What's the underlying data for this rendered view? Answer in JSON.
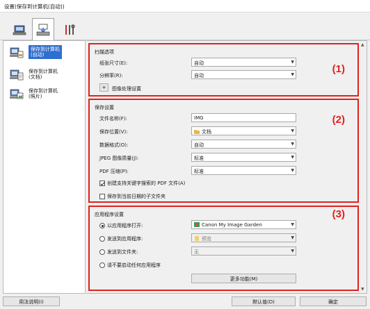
{
  "window": {
    "title": "设置(保存到计算机(自动))"
  },
  "toolbar": {
    "tabs": [
      {
        "icon": "scan-from-computer-icon"
      },
      {
        "icon": "scan-from-panel-icon",
        "active": true
      },
      {
        "icon": "general-settings-icon"
      }
    ]
  },
  "sidebar": {
    "items": [
      {
        "label": "保存到计算机\n(自动)",
        "icon": "auto-save-icon",
        "selected": true
      },
      {
        "label": "保存到计算机\n(文档)",
        "icon": "document-save-icon"
      },
      {
        "label": "保存到计算机\n(照片)",
        "icon": "photo-save-icon"
      }
    ]
  },
  "scan_options": {
    "title": "扫描选项",
    "number": "(1)",
    "paper_size_label": "纸张尺寸(E):",
    "paper_size_value": "自动",
    "resolution_label": "分辨率(R):",
    "resolution_value": "自动",
    "expand_button": "+",
    "image_processing_label": "图像处理设置"
  },
  "save_settings": {
    "title": "保存设置",
    "number": "(2)",
    "file_name_label": "文件名称(F):",
    "file_name_value": "IMG",
    "save_in_label": "保存位置(V):",
    "save_in_value": "文档",
    "data_format_label": "数据格式(O):",
    "data_format_value": "自动",
    "jpeg_quality_label": "JPEG 图像质量(J):",
    "jpeg_quality_value": "标准",
    "pdf_compression_label": "PDF 压缩(P):",
    "pdf_compression_value": "标准",
    "create_pdf_checkbox": "创建支持关键字搜索的 PDF 文件(A)",
    "create_pdf_checked": true,
    "subfolder_checkbox": "保存到当前日期的子文件夹",
    "subfolder_checked": false
  },
  "app_settings": {
    "title": "应用程序设置",
    "number": "(3)",
    "open_with_app_label": "以应用程序打开:",
    "open_with_app_value": "Canon My Image Garden",
    "send_to_app_label": "发送到应用程序:",
    "send_to_app_value": "预览",
    "send_to_folder_label": "发送到文件夹:",
    "send_to_folder_value": "无",
    "do_not_start_label": "请不要启动任何应用程序",
    "more_functions_button": "更多功能(M)"
  },
  "footer": {
    "instructions_button": "用法说明(I)",
    "defaults_button": "默认值(D)",
    "ok_button": "确定"
  },
  "colors": {
    "highlight": "#e2201c",
    "selection": "#2f6fcf"
  }
}
